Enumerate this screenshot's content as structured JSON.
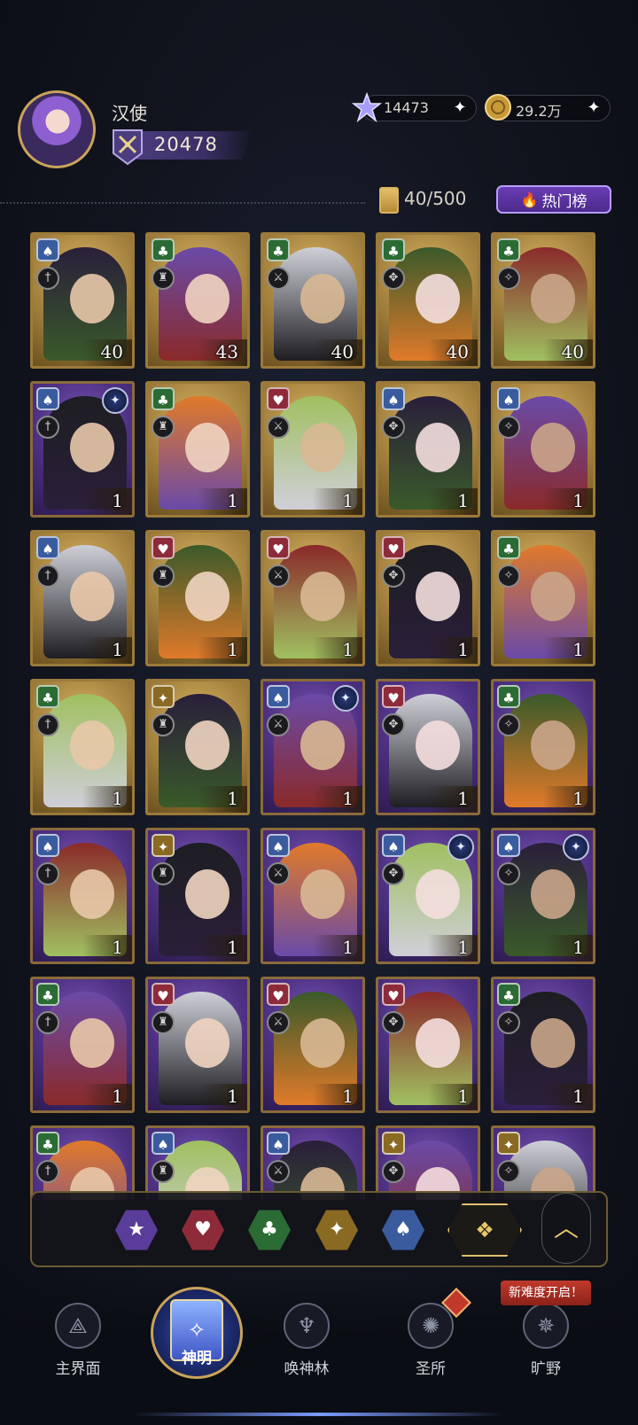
{
  "player": {
    "name": "汉使",
    "score": "20478"
  },
  "currencies": [
    {
      "icon": "star-crystal-icon",
      "value": "14473"
    },
    {
      "icon": "gold-coin-icon",
      "value": "29.2万"
    }
  ],
  "collection": {
    "capacity": "40/500",
    "hot_label": "热门榜"
  },
  "colors": {
    "spade": "#3a5c9e",
    "heart": "#8e2b3a",
    "club": "#2b6b34",
    "diamond": "#8a6a22",
    "star": "#5a3d9a",
    "accent": "#c9a45a"
  },
  "cards": [
    {
      "suit": "spade",
      "level": "40",
      "frame": "gold",
      "star": false
    },
    {
      "suit": "club",
      "level": "43",
      "frame": "gold",
      "star": false
    },
    {
      "suit": "club",
      "level": "40",
      "frame": "gold",
      "star": false
    },
    {
      "suit": "club",
      "level": "40",
      "frame": "gold",
      "star": false
    },
    {
      "suit": "club",
      "level": "40",
      "frame": "gold",
      "star": false
    },
    {
      "suit": "spade",
      "level": "1",
      "frame": "purple",
      "star": true
    },
    {
      "suit": "club",
      "level": "1",
      "frame": "gold",
      "star": false
    },
    {
      "suit": "heart",
      "level": "1",
      "frame": "gold",
      "star": false
    },
    {
      "suit": "spade",
      "level": "1",
      "frame": "gold",
      "star": false
    },
    {
      "suit": "spade",
      "level": "1",
      "frame": "gold",
      "star": false
    },
    {
      "suit": "spade",
      "level": "1",
      "frame": "gold",
      "star": false
    },
    {
      "suit": "heart",
      "level": "1",
      "frame": "gold",
      "star": false
    },
    {
      "suit": "heart",
      "level": "1",
      "frame": "gold",
      "star": false
    },
    {
      "suit": "heart",
      "level": "1",
      "frame": "gold",
      "star": false
    },
    {
      "suit": "club",
      "level": "1",
      "frame": "gold",
      "star": false
    },
    {
      "suit": "club",
      "level": "1",
      "frame": "gold",
      "star": false
    },
    {
      "suit": "diamond",
      "level": "1",
      "frame": "gold",
      "star": false
    },
    {
      "suit": "spade",
      "level": "1",
      "frame": "purple",
      "star": true
    },
    {
      "suit": "heart",
      "level": "1",
      "frame": "purple",
      "star": false
    },
    {
      "suit": "club",
      "level": "1",
      "frame": "purple",
      "star": false
    },
    {
      "suit": "spade",
      "level": "1",
      "frame": "purple",
      "star": false
    },
    {
      "suit": "diamond",
      "level": "1",
      "frame": "purple",
      "star": false
    },
    {
      "suit": "spade",
      "level": "1",
      "frame": "purple",
      "star": false
    },
    {
      "suit": "spade",
      "level": "1",
      "frame": "purple",
      "star": true
    },
    {
      "suit": "spade",
      "level": "1",
      "frame": "purple",
      "star": true
    },
    {
      "suit": "club",
      "level": "1",
      "frame": "purple",
      "star": false
    },
    {
      "suit": "heart",
      "level": "1",
      "frame": "purple",
      "star": false
    },
    {
      "suit": "heart",
      "level": "1",
      "frame": "purple",
      "star": false
    },
    {
      "suit": "heart",
      "level": "1",
      "frame": "purple",
      "star": false
    },
    {
      "suit": "club",
      "level": "1",
      "frame": "purple",
      "star": false
    },
    {
      "suit": "club",
      "level": "",
      "frame": "purple",
      "star": false
    },
    {
      "suit": "spade",
      "level": "",
      "frame": "purple",
      "star": false
    },
    {
      "suit": "spade",
      "level": "",
      "frame": "purple",
      "star": false
    },
    {
      "suit": "diamond",
      "level": "",
      "frame": "purple",
      "star": false
    },
    {
      "suit": "diamond",
      "level": "",
      "frame": "purple",
      "star": false
    }
  ],
  "filters": [
    {
      "name": "star",
      "icon": "star-filter-icon",
      "glyph": "★"
    },
    {
      "name": "heart",
      "icon": "heart-filter-icon",
      "glyph": "♥"
    },
    {
      "name": "club",
      "icon": "club-filter-icon",
      "glyph": "♣"
    },
    {
      "name": "diamond",
      "icon": "diamond-filter-icon",
      "glyph": "✦"
    },
    {
      "name": "spade",
      "icon": "spade-filter-icon",
      "glyph": "♠"
    }
  ],
  "nav": {
    "items": [
      {
        "label": "主界面",
        "icon": "home-icon"
      },
      {
        "label": "神明",
        "icon": "card-book-icon"
      },
      {
        "label": "唤神林",
        "icon": "tree-icon"
      },
      {
        "label": "圣所",
        "icon": "sanctuary-icon"
      },
      {
        "label": "旷野",
        "icon": "compass-icon"
      }
    ],
    "new_badge": "新难度开启！"
  }
}
